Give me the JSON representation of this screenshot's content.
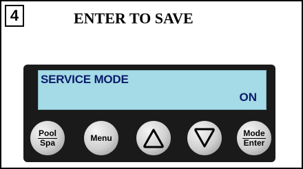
{
  "step": {
    "number": "4"
  },
  "title": "ENTER TO SAVE",
  "display": {
    "line1": "SERVICE MODE",
    "line2": "ON"
  },
  "buttons": {
    "pool_spa": {
      "top": "Pool",
      "bottom": "Spa"
    },
    "menu": {
      "label": "Menu"
    },
    "up": {
      "icon": "up-triangle-icon"
    },
    "down": {
      "icon": "down-triangle-icon"
    },
    "mode_enter": {
      "top": "Mode",
      "bottom": "Enter"
    }
  },
  "colors": {
    "lcd_background": "#a4dbe6",
    "lcd_text": "#0b1a6a",
    "panel": "#1a1a1a",
    "border": "#000000"
  }
}
